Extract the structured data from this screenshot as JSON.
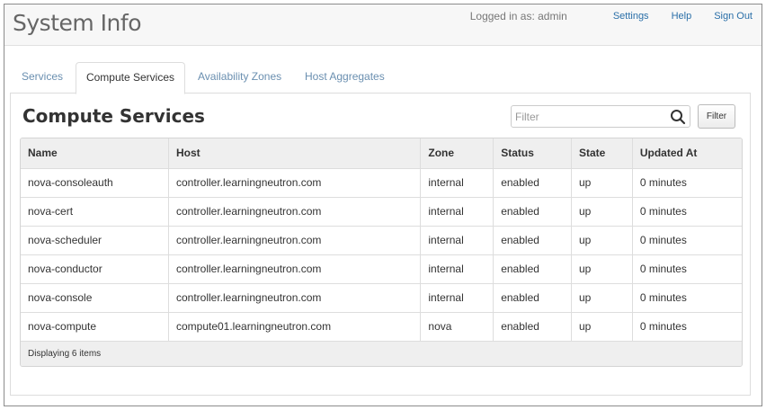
{
  "header": {
    "title": "System Info",
    "logged_in": "Logged in as: admin",
    "links": [
      "Settings",
      "Help",
      "Sign Out"
    ]
  },
  "tabs": [
    {
      "label": "Services",
      "active": false
    },
    {
      "label": "Compute Services",
      "active": true
    },
    {
      "label": "Availability Zones",
      "active": false
    },
    {
      "label": "Host Aggregates",
      "active": false
    }
  ],
  "section": {
    "title": "Compute Services",
    "filter_placeholder": "Filter",
    "filter_button": "Filter"
  },
  "table": {
    "columns": [
      "Name",
      "Host",
      "Zone",
      "Status",
      "State",
      "Updated At"
    ],
    "rows": [
      [
        "nova-consoleauth",
        "controller.learningneutron.com",
        "internal",
        "enabled",
        "up",
        "0 minutes"
      ],
      [
        "nova-cert",
        "controller.learningneutron.com",
        "internal",
        "enabled",
        "up",
        "0 minutes"
      ],
      [
        "nova-scheduler",
        "controller.learningneutron.com",
        "internal",
        "enabled",
        "up",
        "0 minutes"
      ],
      [
        "nova-conductor",
        "controller.learningneutron.com",
        "internal",
        "enabled",
        "up",
        "0 minutes"
      ],
      [
        "nova-console",
        "controller.learningneutron.com",
        "internal",
        "enabled",
        "up",
        "0 minutes"
      ],
      [
        "nova-compute",
        "compute01.learningneutron.com",
        "nova",
        "enabled",
        "up",
        "0 minutes"
      ]
    ],
    "footer": "Displaying 6 items"
  },
  "colors": {
    "link": "#2a6fa8",
    "tab_inactive": "#6a8fb0",
    "header_bg": "#f7f7f7"
  },
  "icons": {
    "filter_search": "search-icon"
  }
}
